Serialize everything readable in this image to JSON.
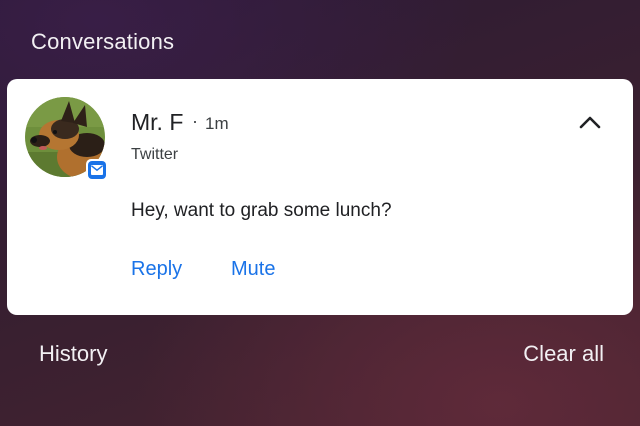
{
  "section": {
    "title": "Conversations"
  },
  "notification": {
    "sender": "Mr. F",
    "separator": "·",
    "time": "1m",
    "app": "Twitter",
    "app_badge_icon": "mail-icon",
    "avatar": "german-shepherd-dog-photo",
    "message": "Hey, want to grab some lunch?",
    "actions": {
      "reply": "Reply",
      "mute": "Mute"
    },
    "expand_icon": "chevron-up-icon"
  },
  "footer": {
    "history": "History",
    "clear_all": "Clear all"
  },
  "colors": {
    "accent": "#1a73e8",
    "card": "#ffffff",
    "text_on_dark": "#f2f0f3"
  }
}
